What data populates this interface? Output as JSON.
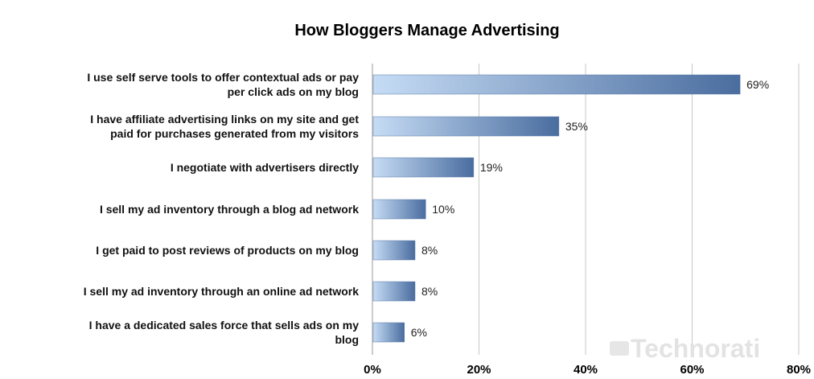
{
  "chart_data": {
    "type": "bar",
    "orientation": "horizontal",
    "title": "How Bloggers Manage Advertising",
    "categories": [
      [
        "I use self serve tools to offer contextual ads or pay",
        "per click ads on my blog"
      ],
      [
        "I have affiliate advertising links on my site and get",
        "paid for purchases generated from my visitors"
      ],
      [
        "I negotiate with advertisers directly"
      ],
      [
        "I sell my ad inventory through a blog ad network"
      ],
      [
        "I get paid to post reviews of products on my blog"
      ],
      [
        "I sell my ad inventory through an online ad network"
      ],
      [
        "I have a dedicated sales force that sells ads on my",
        "blog"
      ]
    ],
    "values": [
      69,
      35,
      19,
      10,
      8,
      8,
      6
    ],
    "value_labels": [
      "69%",
      "35%",
      "19%",
      "10%",
      "8%",
      "8%",
      "6%"
    ],
    "xlim": [
      0,
      80
    ],
    "xticks": [
      0,
      20,
      40,
      60,
      80
    ],
    "xtick_labels": [
      "0%",
      "20%",
      "40%",
      "60%",
      "80%"
    ],
    "grid": true,
    "watermark": "Technorati",
    "colors": {
      "bar_light": "#c6dcf5",
      "bar_dark": "#4a6d9f",
      "grid": "#c8c8c8"
    }
  }
}
